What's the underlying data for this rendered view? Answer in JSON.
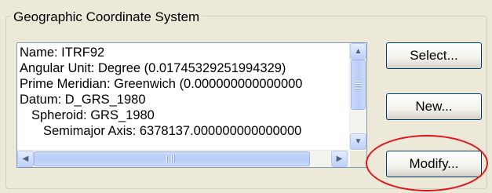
{
  "groupbox": {
    "title": "Geographic Coordinate System"
  },
  "details": {
    "lines": [
      "Name: ITRF92",
      "Angular Unit: Degree (0.01745329251994329)",
      "Prime Meridian: Greenwich (0.000000000000000",
      "Datum: D_GRS_1980",
      "Spheroid: GRS_1980",
      "Semimajor Axis: 6378137.000000000000000"
    ]
  },
  "buttons": {
    "select": "Select...",
    "new": "New...",
    "modify": "Modify..."
  },
  "annotation": {
    "color": "#e0121b"
  }
}
